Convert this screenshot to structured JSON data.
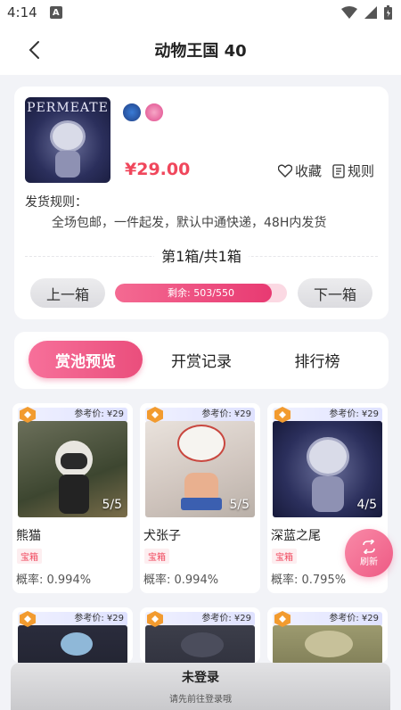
{
  "status": {
    "time": "4:14",
    "notif_letter": "A"
  },
  "nav": {
    "title": "动物王国 40"
  },
  "product": {
    "cover_text": "PERMEATE",
    "price": "¥29.00",
    "favorite_label": "收藏",
    "rules_label": "规则",
    "shipping_label": "发货规则：",
    "shipping_text": "全场包邮，一件起发，默认中通快递，48H内发货",
    "box_count": "第1箱/共1箱",
    "prev_label": "上一箱",
    "next_label": "下一箱",
    "remaining_label": "剩余: 503/550",
    "remaining_fraction": 0.9145
  },
  "tabs": [
    {
      "label": "赏池预览",
      "active": true
    },
    {
      "label": "开赏记录",
      "active": false
    },
    {
      "label": "排行榜",
      "active": false
    }
  ],
  "items": [
    {
      "ref_price": "参考价: ¥29",
      "count": "5/5",
      "name": "熊猫",
      "tag": "宝箱",
      "prob": "概率: 0.994%"
    },
    {
      "ref_price": "参考价: ¥29",
      "count": "5/5",
      "name": "犬张子",
      "tag": "宝箱",
      "prob": "概率: 0.994%"
    },
    {
      "ref_price": "参考价: ¥29",
      "count": "4/5",
      "name": "深蓝之尾",
      "tag": "宝箱",
      "prob": "概率: 0.795%"
    },
    {
      "ref_price": "参考价: ¥29"
    },
    {
      "ref_price": "参考价: ¥29"
    },
    {
      "ref_price": "参考价: ¥29"
    }
  ],
  "refresh_label": "刷新",
  "login": {
    "title": "未登录",
    "subtitle": "请先前往登录哦"
  },
  "colors": {
    "accent": "#ea4e7c",
    "price": "#f0475c"
  }
}
